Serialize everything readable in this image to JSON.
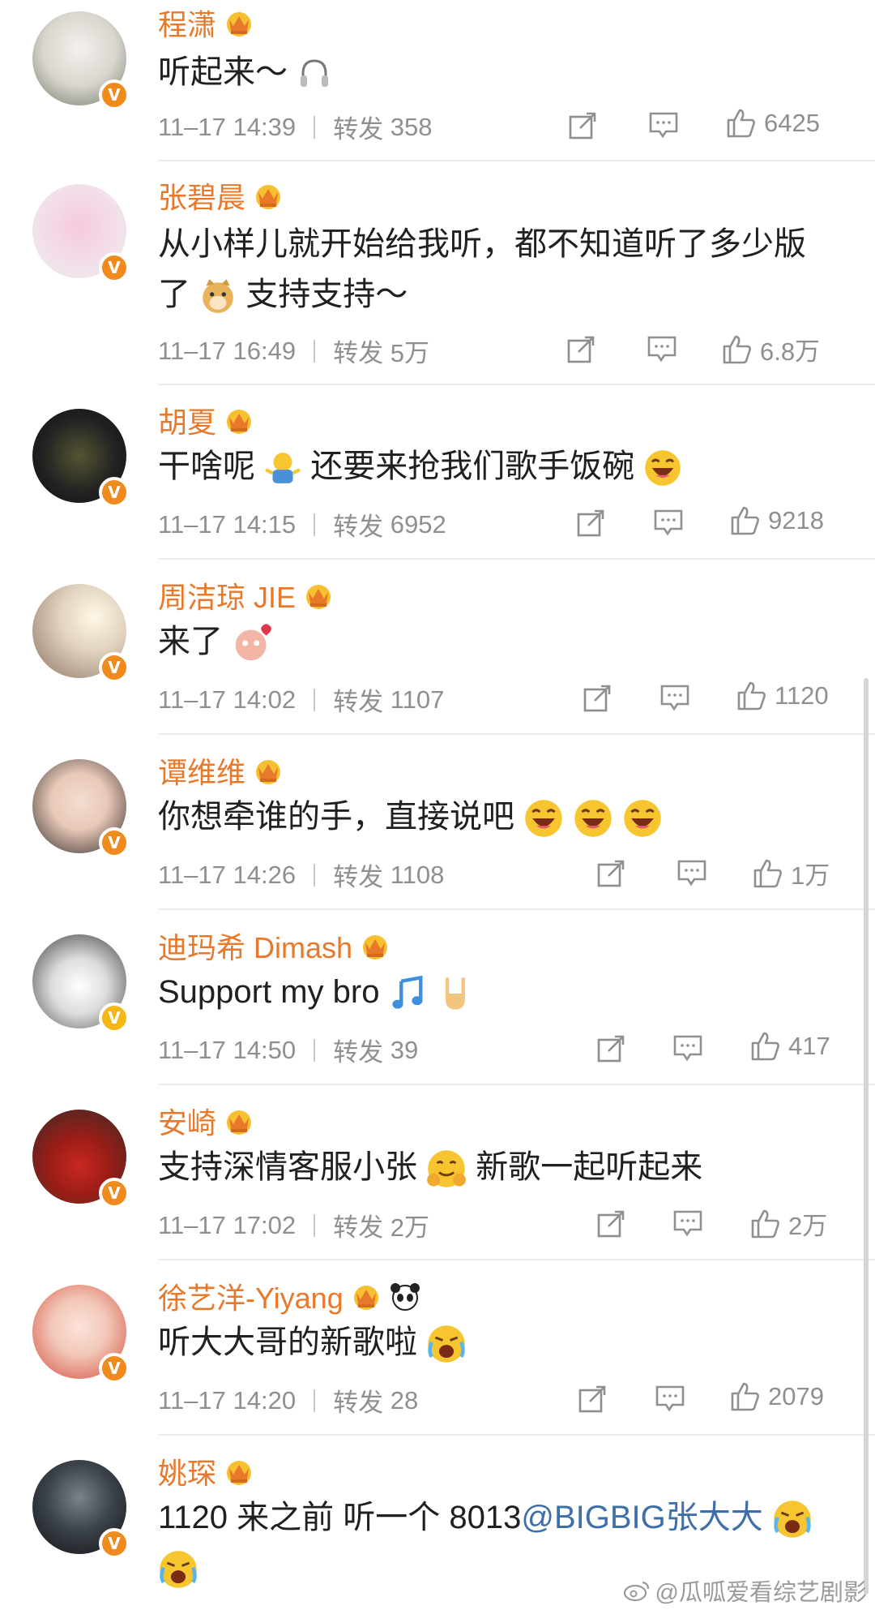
{
  "labels": {
    "repost": "转发"
  },
  "comments": [
    {
      "name": "程潇",
      "text": "听起来～",
      "time": "11–17 14:39",
      "reposts": "358",
      "likes": "6425"
    },
    {
      "name": "张碧晨",
      "text": "从小样儿就开始给我听，都不知道听了多少版",
      "text2": "了",
      "text2b": "支持支持～",
      "time": "11–17 16:49",
      "reposts": "5万",
      "likes": "6.8万"
    },
    {
      "name": "胡夏",
      "text": "干啥呢",
      "textb": "还要来抢我们歌手饭碗",
      "time": "11–17 14:15",
      "reposts": "6952",
      "likes": "9218"
    },
    {
      "name": "周洁琼 JIE",
      "text": "来了",
      "time": "11–17 14:02",
      "reposts": "1107",
      "likes": "1120"
    },
    {
      "name": "谭维维",
      "text": "你想牵谁的手，直接说吧",
      "time": "11–17 14:26",
      "reposts": "1108",
      "likes": "1万"
    },
    {
      "name": "迪玛希 Dimash",
      "text": "Support my bro",
      "time": "11–17 14:50",
      "reposts": "39",
      "likes": "417"
    },
    {
      "name": "安崎",
      "text": "支持深情客服小张",
      "textb": "新歌一起听起来",
      "time": "11–17 17:02",
      "reposts": "2万",
      "likes": "2万"
    },
    {
      "name": "徐艺洋-Yiyang",
      "text": "听大大哥的新歌啦",
      "time": "11–17 14:20",
      "reposts": "28",
      "likes": "2079"
    },
    {
      "name": "姚琛",
      "text": "1120 来之前 听一个 8013",
      "mention": "@BIGBIG张大大",
      "time": "",
      "reposts": "",
      "likes": ""
    }
  ],
  "watermark": "@瓜呱爱看综艺剧影",
  "colors": {
    "name": "#e8782a",
    "mention": "#3e6fa8",
    "meta": "#8f8f8f",
    "badge": "#f08a1c"
  }
}
